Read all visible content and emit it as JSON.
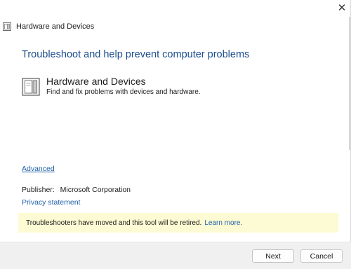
{
  "window": {
    "title": "Hardware and Devices",
    "close_glyph": "✕"
  },
  "main": {
    "heading": "Troubleshoot and help prevent computer problems",
    "item": {
      "title": "Hardware and Devices",
      "description": "Find and fix problems with devices and hardware."
    },
    "advanced_link": "Advanced",
    "publisher_label": "Publisher:",
    "publisher_value": "Microsoft Corporation",
    "privacy_link": "Privacy statement",
    "notice": {
      "text": "Troubleshooters have moved and this tool will be retired.",
      "link": "Learn more."
    }
  },
  "footer": {
    "next_label": "Next",
    "cancel_label": "Cancel"
  },
  "icons": {
    "window_icon": "troubleshooter-icon",
    "item_icon": "troubleshooter-icon"
  },
  "colors": {
    "heading": "#1a4d8c",
    "link": "#1f5fa8",
    "notice_bg": "#fdfbd3",
    "footer_bg": "#f0f0f0"
  }
}
